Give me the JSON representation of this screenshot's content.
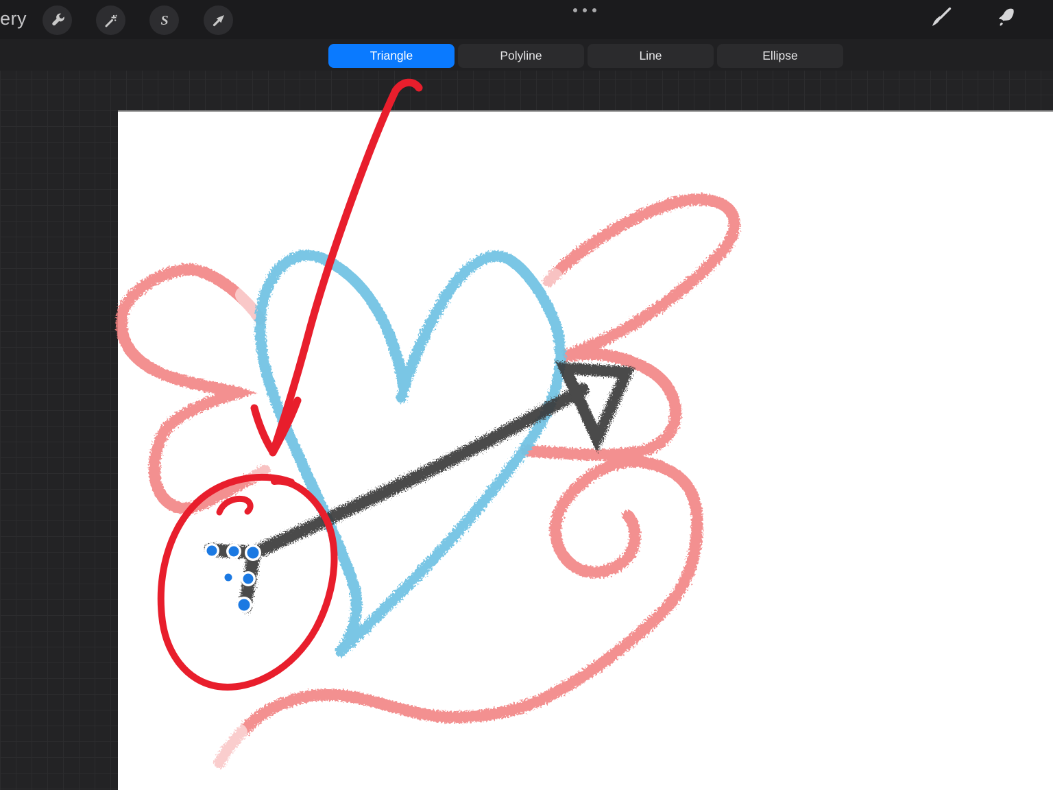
{
  "topbar": {
    "gallery_label_partial": "ery",
    "more_options_icon": "ellipsis •••",
    "left_buttons": [
      {
        "icon": "wrench-icon",
        "meaning": "actions"
      },
      {
        "icon": "magic-wand-icon",
        "meaning": "adjustments"
      },
      {
        "icon": "curve-s-icon",
        "meaning": "selection"
      },
      {
        "icon": "transform-arrow-icon",
        "meaning": "transform"
      }
    ],
    "adjustments_glyph": "S",
    "right_buttons": [
      {
        "icon": "brush-icon",
        "meaning": "paint"
      },
      {
        "icon": "smudge-icon",
        "meaning": "smudge"
      }
    ]
  },
  "segments": {
    "selected_index": 0,
    "selected_color": "#0a7aff",
    "options": [
      {
        "label": "Triangle"
      },
      {
        "label": "Polyline"
      },
      {
        "label": "Line"
      },
      {
        "label": "Ellipse"
      }
    ]
  },
  "art": {
    "colors": {
      "coral": "#f28080",
      "heart_blue": "#73c3e4",
      "charcoal": "#3a3a3a",
      "annotation_red": "#e81e2c",
      "node_blue": "#1b79e2",
      "node_ring": "#ffffff",
      "canvas_white": "#ffffff"
    },
    "edit_node_count": 6
  }
}
